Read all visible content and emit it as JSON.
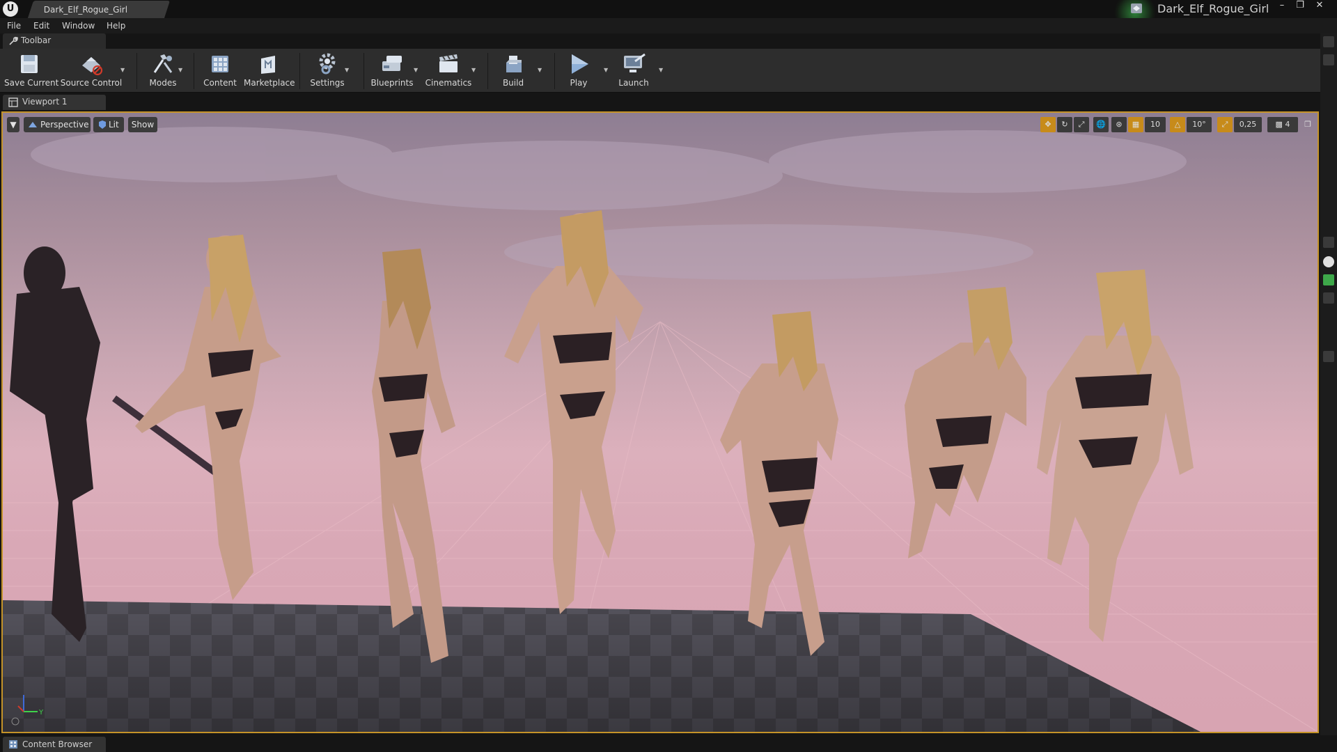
{
  "window": {
    "doc_tab": "Dark_Elf_Rogue_Girl",
    "project_name": "Dark_Elf_Rogue_Girl",
    "controls": [
      "minimize",
      "maximize",
      "close"
    ]
  },
  "menu": [
    "File",
    "Edit",
    "Window",
    "Help"
  ],
  "toolbar_tab": "Toolbar",
  "toolbar": {
    "save_current": "Save Current",
    "source_control": "Source Control",
    "modes": "Modes",
    "content": "Content",
    "marketplace": "Marketplace",
    "settings": "Settings",
    "blueprints": "Blueprints",
    "cinematics": "Cinematics",
    "build": "Build",
    "play": "Play",
    "launch": "Launch"
  },
  "viewport_tab": "Viewport 1",
  "viewport": {
    "perspective": "Perspective",
    "lit": "Lit",
    "show": "Show",
    "grid_snap": "10",
    "rotation_snap": "10°",
    "scale_snap": "0,25",
    "camera_speed": "4",
    "scene_description": "Seven female character models in dance poses on a checkered floor under a pink sky"
  },
  "content_browser_tab": "Content Browser",
  "colors": {
    "accent_orange": "#c78b1a",
    "viewport_border": "#c59328",
    "project_glow": "#46dc5a"
  }
}
